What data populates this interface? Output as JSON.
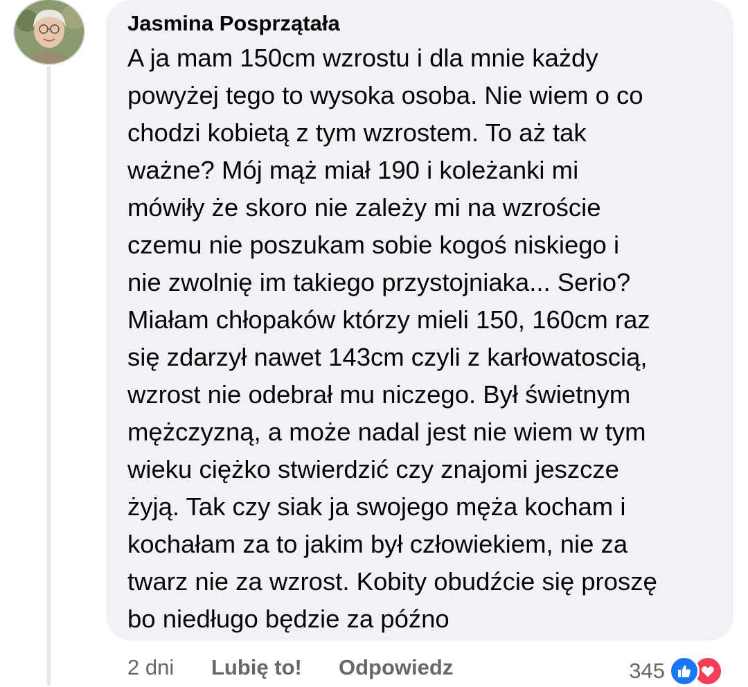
{
  "comment": {
    "author": "Jasmina Posprzątała",
    "lines": [
      "A ja mam 150cm wzrostu i dla mnie każdy",
      "powyżej tego to wysoka osoba. Nie wiem o co",
      "chodzi kobietą z tym wzrostem. To aż tak",
      "ważne? Mój mąż miał 190 i koleżanki mi",
      "mówiły że skoro nie zależy mi na wzroście",
      "czemu nie poszukam sobie kogoś niskiego i",
      "nie zwolnię im takiego przystojniaka... Serio?",
      "Miałam chłopaków którzy mieli 150, 160cm raz",
      "się zdarzył nawet 143cm czyli z karłowatoscią,",
      "wzrost nie odebrał mu niczego. Był świetnym",
      "mężczyzną, a może nadal jest nie wiem w tym",
      "wieku ciężko stwierdzić czy znajomi jeszcze",
      "żyją. Tak czy siak ja swojego męża kocham i",
      "kochałam za to jakim był człowiekiem, nie za",
      "twarz nie za wzrost. Kobity obudźcie się proszę",
      "bo niedługo będzie za późno"
    ]
  },
  "actions": {
    "time": "2 dni",
    "like_label": "Lubię to!",
    "reply_label": "Odpowiedz"
  },
  "reactions": {
    "count": "345",
    "icons": [
      "like-icon",
      "love-icon"
    ],
    "colors": {
      "like": "#1877f2",
      "love": "#f33e58"
    }
  }
}
